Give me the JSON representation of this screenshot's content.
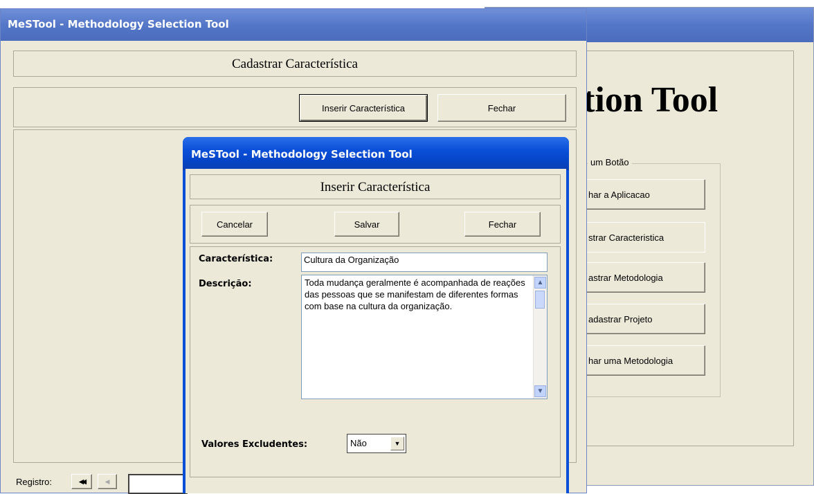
{
  "main_window": {
    "title": "MeSTool - Methodology Selection Tool",
    "heading_partial": "ction Tool",
    "group_label_partial": "um Botão",
    "buttons": [
      {
        "label": "har a Aplicacao"
      },
      {
        "label": "strar Caracteristica"
      },
      {
        "label": "astrar Metodologia"
      },
      {
        "label": "adastrar Projeto"
      },
      {
        "label": "har uma Metodologia"
      }
    ]
  },
  "cadastrar_window": {
    "title": "MeSTool - Methodology Selection Tool",
    "header": "Cadastrar Característica",
    "inserir_button": "Inserir Característica",
    "fechar_button": "Fechar",
    "record_label": "Registro:",
    "nav_first": "◀◀",
    "nav_prev": "◀"
  },
  "inserir_dialog": {
    "title": "MeSTool - Methodology Selection Tool",
    "header": "Inserir Característica",
    "buttons": {
      "cancelar": "Cancelar",
      "salvar": "Salvar",
      "fechar": "Fechar"
    },
    "caracteristica_label": "Característica:",
    "caracteristica_value": "Cultura da Organização",
    "descricao_label": "Descrição:",
    "descricao_value": "Toda mudança geralmente é acompanhada de reações das pessoas que se manifestam de diferentes formas com base na cultura da organização.",
    "valores_label": "Valores Excludentes:",
    "valores_value": "Não"
  },
  "colors": {
    "xp_blue": "#0a4fd8",
    "face": "#ece9d8"
  }
}
